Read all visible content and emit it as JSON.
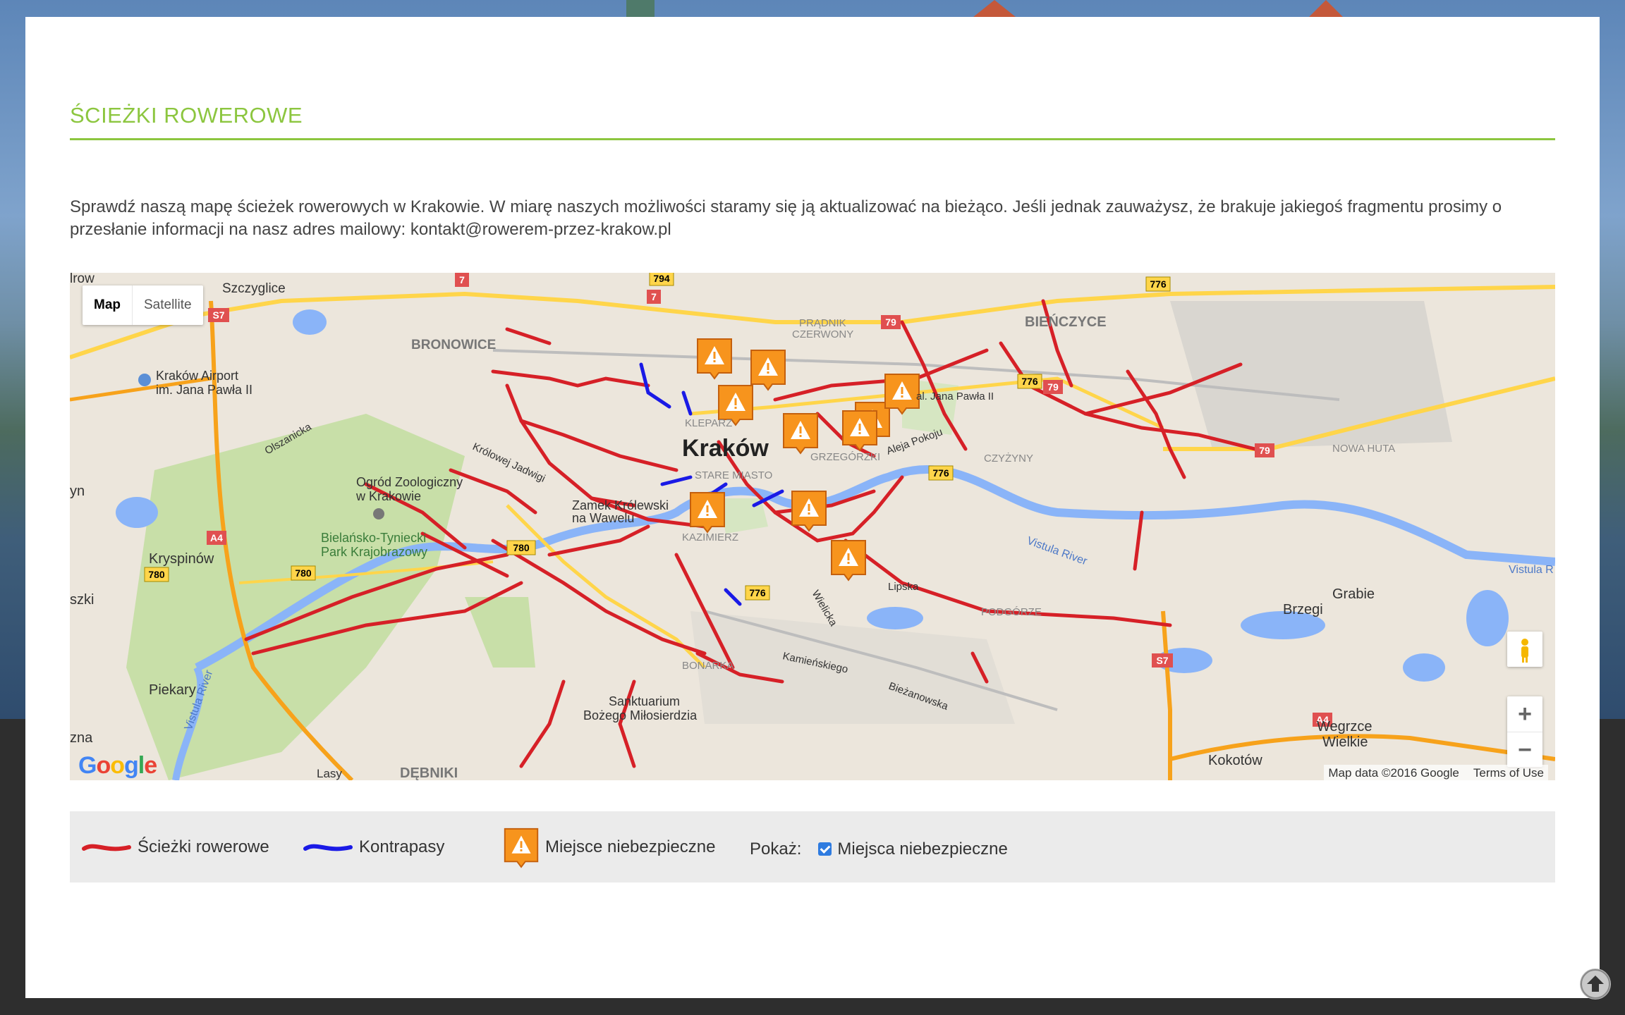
{
  "page": {
    "title": "ŚCIEŻKI ROWEROWE",
    "intro": "Sprawdź naszą mapę ścieżek rowerowych w Krakowie. W miarę naszych możliwości staramy się ją aktualizować na bieżąco. Jeśli jednak zauważysz, że brakuje jakiegoś fragmentu prosimy o przesłanie informacji na nasz adres mailowy: kontakt@rowerem-przez-krakow.pl"
  },
  "map": {
    "type_buttons": [
      {
        "label": "Map",
        "active": true
      },
      {
        "label": "Satellite",
        "active": false
      }
    ],
    "zoom_in": "+",
    "zoom_out": "−",
    "logo_text": "Google",
    "attribution": "Map data ©2016 Google",
    "terms": "Terms of Use",
    "labels": {
      "city": "Kraków",
      "stare_miasto": "STARE MIASTO",
      "kazimierz": "KAZIMIERZ",
      "klepary": "KLEPARZ",
      "grzegorzki": "GRZEGÓRZKI",
      "bronowice": "BRONOWICE",
      "szczyglice": "Szczyglice",
      "airport1": "Kraków Airport",
      "airport2": "im. Jana Pawła II",
      "zoo1": "Ogród Zoologiczny",
      "zoo2": "w Krakowie",
      "park1": "Bielańsko-Tyniecki",
      "park2": "Park Krajobrazowy",
      "kryspinow": "Kryspinów",
      "piekary": "Piekary",
      "debniki": "DĘBNIKI",
      "zamek1": "Zamek Królewski",
      "zamek2": "na Wawelu",
      "sanktuarium1": "Sanktuarium",
      "sanktuarium2": "Bożego Miłosierdzia",
      "bonarka": "BONARKA",
      "podgorze": "PODGÓRZE",
      "czyzyny": "CZYŻYNY",
      "bienczyce": "BIEŃCZYCE",
      "pradnik1": "PRĄDNIK",
      "pradnik2": "CZERWONY",
      "nowa_huta": "NOWA HUTA",
      "grabie": "Grabie",
      "brzegi": "Brzegi",
      "wegrzce1": "Wegrzce",
      "wegrzce2": "Wielkie",
      "kokotow": "Kokotów",
      "vistula1": "Vistula River",
      "vistula2": "Vistula River",
      "vistula3": "Vistula R",
      "lipska": "Lipska",
      "kamienskiego": "Kamieńskiego",
      "biezanowska": "Bieżanowska",
      "wielicka": "Wielicka",
      "jana_pawla": "al. Jana Pawła II",
      "aleja_pokoju": "Aleja Pokoju",
      "krolowej": "Królowej Jadwigi",
      "olszanicka": "Olszanicka",
      "lasy": "Lasy",
      "nizszki": "szki",
      "zna": "zna",
      "yn": "yn",
      "lrow": "lrow",
      "road_794": "794",
      "road_776a": "776",
      "road_776b": "776",
      "road_776c": "776",
      "road_776d": "776",
      "road_780a": "780",
      "road_780b": "780",
      "road_780c": "780",
      "road_79a": "79",
      "road_79b": "79",
      "road_79c": "79",
      "road_7a": "7",
      "road_7b": "7",
      "road_s7a": "S7",
      "road_s7b": "S7",
      "road_a4a": "A4",
      "road_a4b": "A4"
    }
  },
  "legend": {
    "paths_label": "Ścieżki rowerowe",
    "contra_label": "Kontrapasy",
    "danger_label": "Miejsce niebezpieczne",
    "show_label": "Pokaż:",
    "checkbox_label": "Miejsca niebezpieczne",
    "checkbox_checked": true
  },
  "colors": {
    "accent": "#8cc63f",
    "bike_path": "#d62027",
    "contraflow": "#1a1ae6",
    "danger_marker": "#f7941d",
    "water": "#8ab4f8",
    "park": "#c8dfa8"
  },
  "scroll_top_icon": "arrow-up-icon"
}
